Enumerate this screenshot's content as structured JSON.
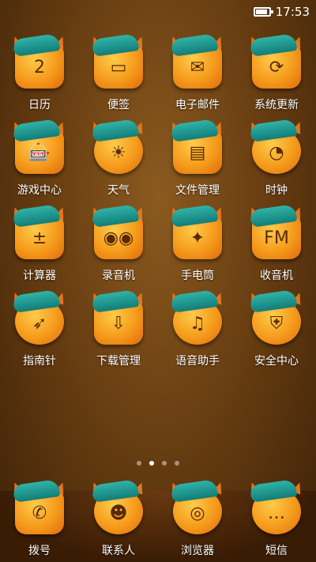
{
  "status": {
    "time": "17:53",
    "battery_level": 0.8
  },
  "apps": [
    {
      "label": "日历",
      "icon": "calendar-icon",
      "glyph": "2"
    },
    {
      "label": "便签",
      "icon": "note-icon",
      "glyph": "▭"
    },
    {
      "label": "电子邮件",
      "icon": "email-icon",
      "glyph": "✉"
    },
    {
      "label": "系统更新",
      "icon": "system-update-icon",
      "glyph": "⟳"
    },
    {
      "label": "游戏中心",
      "icon": "game-center-icon",
      "glyph": "🎰"
    },
    {
      "label": "天气",
      "icon": "weather-icon",
      "glyph": "☀"
    },
    {
      "label": "文件管理",
      "icon": "file-manager-icon",
      "glyph": "▤"
    },
    {
      "label": "时钟",
      "icon": "clock-icon",
      "glyph": "◔"
    },
    {
      "label": "计算器",
      "icon": "calculator-icon",
      "glyph": "±"
    },
    {
      "label": "录音机",
      "icon": "recorder-icon",
      "glyph": "◉◉"
    },
    {
      "label": "手电筒",
      "icon": "flashlight-icon",
      "glyph": "✦"
    },
    {
      "label": "收音机",
      "icon": "radio-icon",
      "glyph": "FM"
    },
    {
      "label": "指南针",
      "icon": "compass-icon",
      "glyph": "➶"
    },
    {
      "label": "下载管理",
      "icon": "download-manager-icon",
      "glyph": "⇩"
    },
    {
      "label": "语音助手",
      "icon": "voice-assistant-icon",
      "glyph": "♫"
    },
    {
      "label": "安全中心",
      "icon": "security-center-icon",
      "glyph": "⛨"
    }
  ],
  "page_indicator": {
    "count": 4,
    "active_index": 1
  },
  "dock": [
    {
      "label": "拨号",
      "icon": "dialer-icon",
      "glyph": "✆"
    },
    {
      "label": "联系人",
      "icon": "contacts-icon",
      "glyph": "☻"
    },
    {
      "label": "浏览器",
      "icon": "browser-icon",
      "glyph": "◎"
    },
    {
      "label": "短信",
      "icon": "messages-icon",
      "glyph": "…"
    }
  ]
}
